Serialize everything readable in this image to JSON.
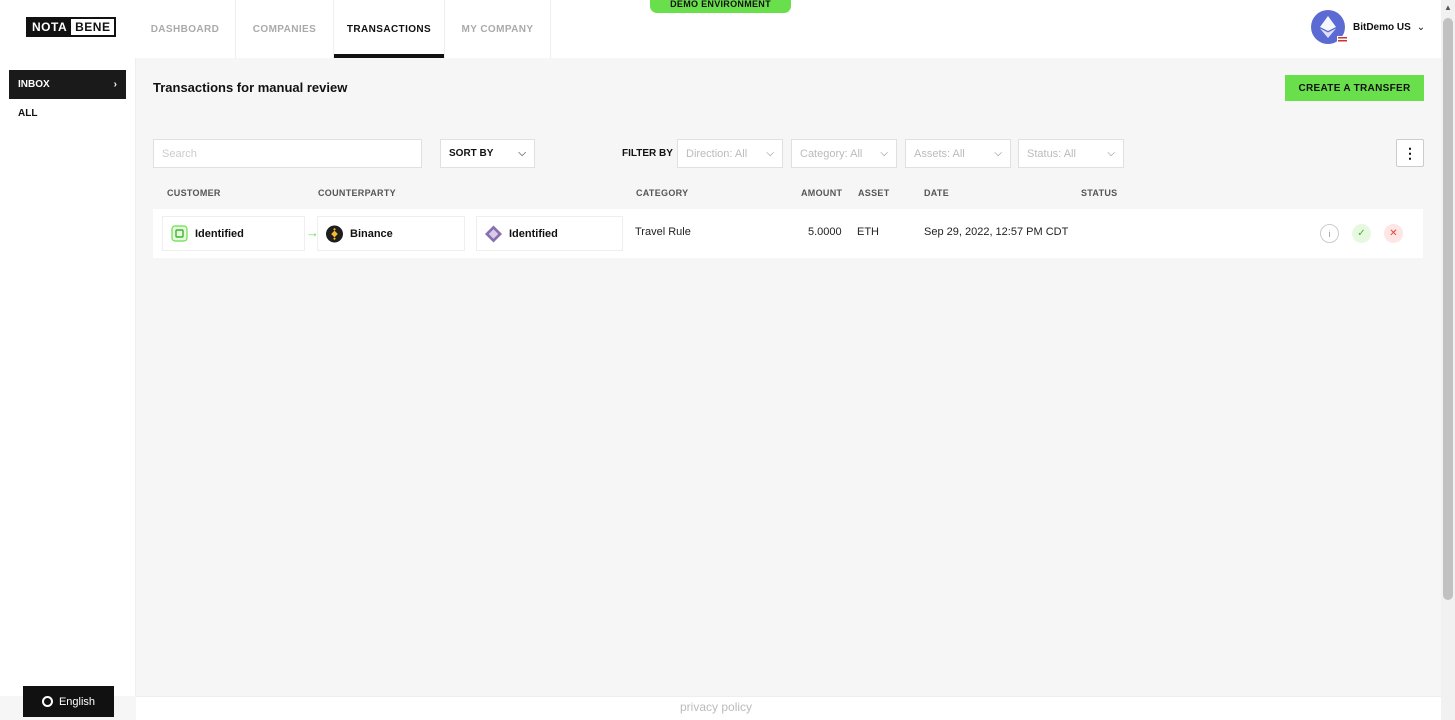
{
  "logo": {
    "part1": "NOTA",
    "part2": "BENE"
  },
  "nav": {
    "tabs": [
      "DASHBOARD",
      "COMPANIES",
      "TRANSACTIONS",
      "MY COMPANY"
    ],
    "active": "TRANSACTIONS"
  },
  "demo_badge": "DEMO ENVIRONMENT",
  "account": {
    "name": "BitDemo US"
  },
  "sidebar": {
    "inbox": "INBOX",
    "all": "ALL"
  },
  "language": "English",
  "page_title": "Transactions for manual review",
  "create_button": "CREATE A TRANSFER",
  "search": {
    "placeholder": "Search",
    "value": ""
  },
  "sort_by": "SORT BY",
  "filter_label": "FILTER BY",
  "filters": [
    "Direction: All",
    "Category: All",
    "Assets: All",
    "Status: All"
  ],
  "columns": [
    "CUSTOMER",
    "COUNTERPARTY",
    "CATEGORY",
    "AMOUNT",
    "ASSET",
    "DATE",
    "STATUS"
  ],
  "rows": [
    {
      "customer": "Identified",
      "counterparty": "Binance",
      "counterparty_status": "Identified",
      "category": "Travel Rule",
      "amount": "5.0000",
      "asset": "ETH",
      "date": "Sep 29, 2022, 12:57 PM CDT"
    }
  ],
  "footer": {
    "privacy": "privacy policy"
  },
  "colors": {
    "accent": "#69df4c",
    "dark": "#111111",
    "reject": "#e0453a"
  }
}
